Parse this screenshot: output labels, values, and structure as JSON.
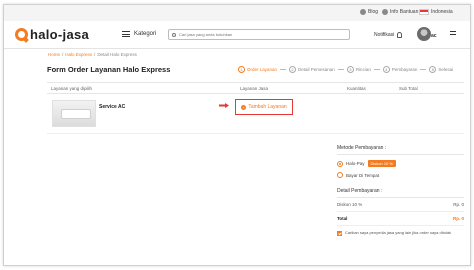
{
  "utility_bar": {
    "blog": "Blog",
    "help": "Info Bantuan",
    "language": "Indonesia"
  },
  "header": {
    "logo_text": "halo-jasa",
    "category_label": "Kategori",
    "search_placeholder": "Cari jasa yang anda butuhkan",
    "notification_label": "Notifikasi",
    "avatar_label": "ac"
  },
  "breadcrumb": [
    "Home",
    "Halo Express",
    "Detail Halo Express"
  ],
  "form": {
    "title": "Form Order Layanan Halo Express",
    "steps": [
      {
        "number": "1",
        "label": "Order Layanan"
      },
      {
        "number": "2",
        "label": "Detail Pemesanan"
      },
      {
        "number": "3",
        "label": "Rincian"
      },
      {
        "number": "4",
        "label": "Pembayaran"
      },
      {
        "number": "5",
        "label": "Selesai"
      }
    ]
  },
  "table": {
    "columns": [
      "Layanan yang dipilih",
      "Layanan Jasa",
      "Kuantitas",
      "Sub Total"
    ],
    "rows": [
      {
        "service": "Service AC",
        "action": "Tambah Layanan"
      }
    ]
  },
  "payment": {
    "method_label": "Metode Pembayaran :",
    "options": [
      {
        "label": "Halo-Pay",
        "badge": "Diskon 10 %",
        "checked": true
      },
      {
        "label": "Bayar Di Tempat",
        "checked": false
      }
    ],
    "detail_label": "Detail Pembayaran :",
    "details": [
      {
        "label": "Diskon 10 %",
        "value": "Rp. 0"
      },
      {
        "label": "Total",
        "value": "Rp. 0"
      }
    ],
    "agreement": "Carikan saya penyedia jasa yang lain jika order saya ditolak"
  },
  "colors": {
    "accent": "#f47b20",
    "highlight": "#e53935"
  }
}
